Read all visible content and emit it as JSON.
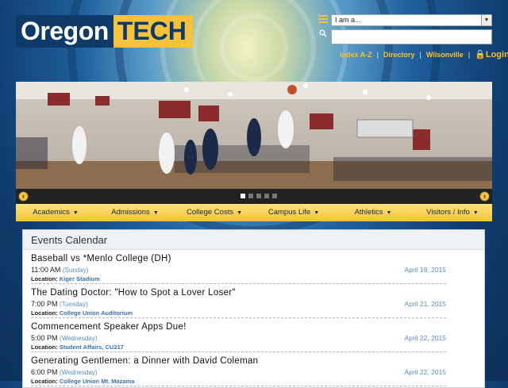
{
  "brand": {
    "word1": "Oregon",
    "word2": "TECH",
    "blue": "#0e3a6a",
    "gold": "#f5c23a"
  },
  "header": {
    "iam_select": "I am a...",
    "search_placeholder": "",
    "links": [
      "Index A-Z",
      "Directory",
      "Wilsonville"
    ],
    "login": "Login"
  },
  "slideshow": {
    "slide_count": 5,
    "active_index": 0,
    "photo": "basketball-game-layup"
  },
  "nav": [
    {
      "label": "Academics"
    },
    {
      "label": "Admissions"
    },
    {
      "label": "College Costs"
    },
    {
      "label": "Campus Life"
    },
    {
      "label": "Athletics"
    },
    {
      "label": "Visitors / Info"
    }
  ],
  "events": {
    "heading": "Events Calendar",
    "location_label": "Location:",
    "items": [
      {
        "title": "Baseball vs *Menlo College (DH)",
        "time": "11:00 AM",
        "day": "(Sunday)",
        "location": "Kiger Stadium",
        "date": "April 19, 2015"
      },
      {
        "title": "The Dating Doctor: \"How to Spot a Lover Loser\"",
        "time": "7:00 PM",
        "day": "(Tuesday)",
        "location": "College Union Auditorium",
        "date": "April 21, 2015"
      },
      {
        "title": "Commencement Speaker Apps Due!",
        "time": "5:00 PM",
        "day": "(Wednesday)",
        "location": "Student Affairs, CU217",
        "date": "April 22, 2015"
      },
      {
        "title": "Generating Gentlemen: a Dinner with David Coleman",
        "time": "6:00 PM",
        "day": "(Wednesday)",
        "location": "College Union Mt. Mazama",
        "date": "April 22, 2015"
      }
    ]
  }
}
